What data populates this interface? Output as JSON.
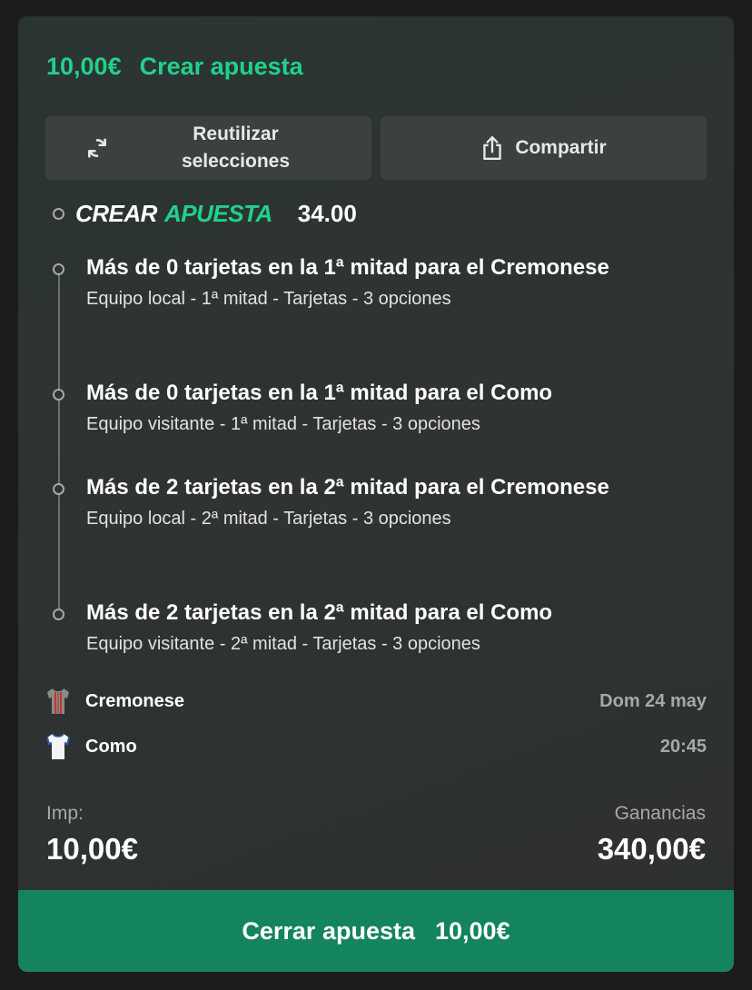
{
  "header": {
    "stake": "10,00€",
    "label": "Crear apuesta"
  },
  "actions": {
    "reuse_label": "Reutilizar selecciones",
    "reuse_line1": "Reutilizar",
    "reuse_line2": "selecciones",
    "share_label": "Compartir"
  },
  "betbuilder": {
    "word1": "CREAR",
    "word2": "APUESTA",
    "odds": "34.00"
  },
  "selections": [
    {
      "title": "Más de 0 tarjetas en la 1ª mitad para el Cremonese",
      "subtitle": "Equipo local - 1ª mitad - Tarjetas - 3 opciones"
    },
    {
      "title": "Más de 0 tarjetas en la 1ª mitad para el Como",
      "subtitle": "Equipo visitante - 1ª mitad - Tarjetas - 3 opciones"
    },
    {
      "title": "Más de 2 tarjetas en la 2ª mitad para el Cremonese",
      "subtitle": "Equipo local - 2ª mitad - Tarjetas - 3 opciones"
    },
    {
      "title": "Más de 2 tarjetas en la 2ª mitad para el Como",
      "subtitle": "Equipo visitante - 2ª mitad - Tarjetas - 3 opciones"
    }
  ],
  "match": {
    "home": {
      "name": "Cremonese",
      "jersey": "cremonese-jersey-icon"
    },
    "away": {
      "name": "Como",
      "jersey": "como-jersey-icon"
    },
    "date": "Dom 24 may",
    "time": "20:45"
  },
  "summary": {
    "stake_label": "Imp:",
    "stake_value": "10,00€",
    "winnings_label": "Ganancias",
    "winnings_value": "340,00€"
  },
  "place_button": {
    "label": "Cerrar apuesta",
    "amount": "10,00€"
  },
  "colors": {
    "accent": "#21d18b",
    "button": "#14835f",
    "card": "#2f3332"
  }
}
